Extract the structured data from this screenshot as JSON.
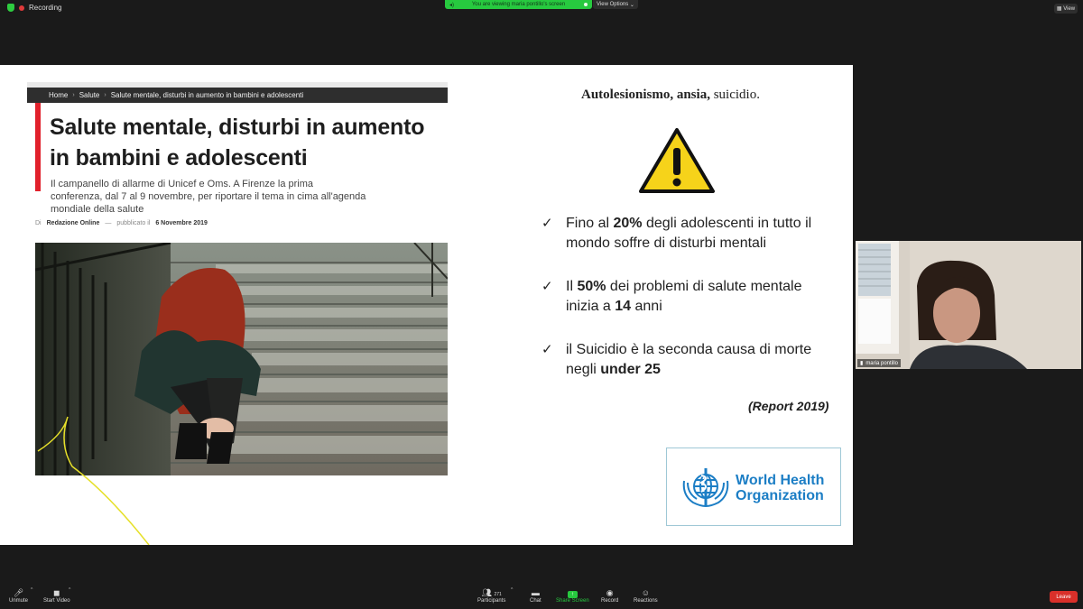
{
  "topbar": {
    "recording_label": "Recording",
    "viewing_banner": "You are viewing maria pontillo's screen",
    "view_options_label": "View Options",
    "view_button_label": "View"
  },
  "slide": {
    "breadcrumb": [
      "Home",
      "Salute",
      "Salute mentale, disturbi in aumento in bambini e adolescenti"
    ],
    "article_title": "Salute mentale, disturbi in aumento in bambini e adolescenti",
    "article_subtitle": "Il campanello di allarme di Unicef e Oms. A Firenze la prima conferenza, dal 7 al 9 novembre, per riportare il tema in cima all'agenda mondiale della salute",
    "byline_prefix": "Di",
    "byline_author": "Redazione Online",
    "byline_published_label": "pubblicato il",
    "byline_date": "6 Novembre 2019",
    "headline_bold": "Autolesionismo, ansia,",
    "headline_plain": "suicidio.",
    "bullets": [
      {
        "pre": "Fino al ",
        "b1": "20%",
        "mid": " degli adolescenti in tutto il mondo soffre di disturbi mentali",
        "b2": "",
        "post": ""
      },
      {
        "pre": "Il ",
        "b1": "50%",
        "mid": " dei problemi di salute mentale inizia a ",
        "b2": "14",
        "post": " anni"
      },
      {
        "pre": "il Suicidio è la seconda causa di morte negli ",
        "b1": "under 25",
        "mid": "",
        "b2": "",
        "post": ""
      }
    ],
    "report_note": "(Report 2019)",
    "who_line1": "World Health",
    "who_line2": "Organization"
  },
  "video_tile": {
    "participant_name": "maria pontillo"
  },
  "toolbar": {
    "unmute_label": "Unmute",
    "start_video_label": "Start Video",
    "participants_label": "Participants",
    "participants_count": "271",
    "chat_label": "Chat",
    "share_screen_label": "Share Screen",
    "record_label": "Record",
    "reactions_label": "Reactions",
    "leave_label": "Leave"
  },
  "colors": {
    "share_green": "#27c93f",
    "leave_red": "#d9302a",
    "article_red_bar": "#e1202b",
    "who_blue": "#1c7ec5",
    "warning_yellow": "#f6d31a"
  },
  "icons": [
    "shield-icon",
    "record-dot-icon",
    "speaker-icon",
    "chevron-down-icon",
    "check-icon",
    "warning-icon",
    "who-emblem-icon",
    "microphone-muted-icon",
    "video-off-icon",
    "participants-icon",
    "chat-icon",
    "share-screen-icon",
    "record-icon",
    "reactions-icon",
    "signal-icon"
  ]
}
